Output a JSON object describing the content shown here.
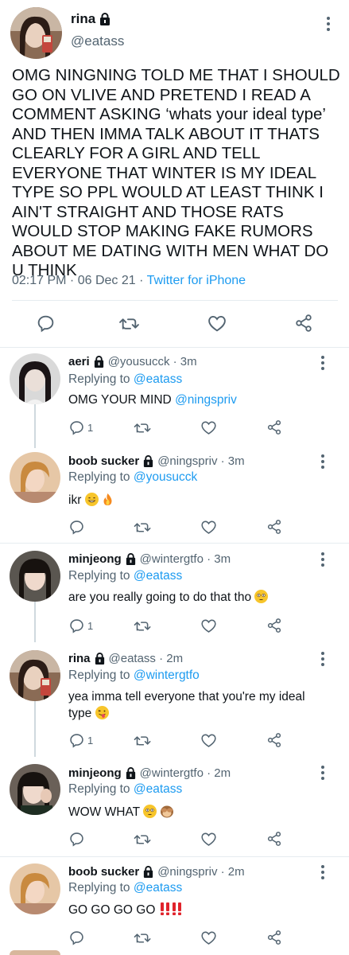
{
  "main": {
    "name": "rina",
    "handle": "@eatass",
    "text": "OMG NINGNING TOLD ME THAT I SHOULD GO ON VLIVE AND PRETEND I READ A COMMENT ASKING ‘whats your ideal type’ AND THEN IMMA TALK ABOUT IT THATS CLEARLY FOR A GIRL AND TELL EVERYONE THAT WINTER IS MY IDEAL TYPE SO PPL WOULD AT LEAST THINK I AIN'T STRAIGHT AND THOSE RATS WOULD STOP MAKING FAKE RUMORS ABOUT ME DATING WITH MEN WHAT DO U THINK",
    "time": "02:17 PM · 06 Dec 21 · ",
    "source": "Twitter for iPhone"
  },
  "replies": [
    {
      "name": "aeri",
      "handle": "@yousucck · 3m",
      "replying_prefix": "Replying to ",
      "replying_to": "@eatass",
      "text": "OMG YOUR MIND ",
      "mention": "@ningspriv",
      "reply_count": "1"
    },
    {
      "name": "boob sucker",
      "handle": "@ningspriv · 3m",
      "replying_prefix": "Replying to ",
      "replying_to": "@yousucck",
      "text": "ikr ",
      "reply_count": ""
    },
    {
      "name": "minjeong",
      "handle": "@wintergtfo · 3m",
      "replying_prefix": "Replying to ",
      "replying_to": "@eatass",
      "text": "are you really going to do that tho ",
      "reply_count": "1"
    },
    {
      "name": "rina",
      "handle": "@eatass · 2m",
      "replying_prefix": "Replying to ",
      "replying_to": "@wintergtfo",
      "text": "yea imma tell everyone that you're my ideal type ",
      "reply_count": "1"
    },
    {
      "name": "minjeong",
      "handle": "@wintergtfo · 2m",
      "replying_prefix": "Replying to ",
      "replying_to": "@eatass",
      "text": "WOW WHAT ",
      "reply_count": ""
    },
    {
      "name": "boob sucker",
      "handle": "@ningspriv · 2m",
      "replying_prefix": "Replying to ",
      "replying_to": "@eatass",
      "text": "GO GO GO GO ",
      "reply_count": ""
    }
  ],
  "colors": {
    "accent": "#1d9bf0",
    "secondary_text": "#536471",
    "primary_text": "#0f1419",
    "divider": "#e6ecf0"
  }
}
